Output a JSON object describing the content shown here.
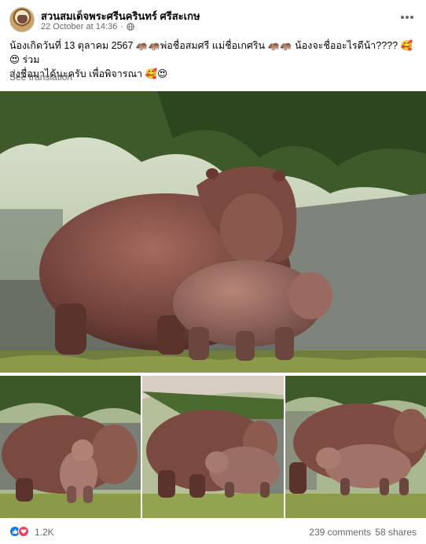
{
  "post": {
    "page_name": "สวนสมเด็จพระศรีนครินทร์ ศรีสะเกษ",
    "timestamp": "22 October at 14:36",
    "privacy_icon": "globe-icon",
    "text_line_1": "น้องเกิดวันที่ 13 ตุลาคม 2567 🦛🦛พ่อชื่อสมศรี แม่ชื่อเกศริน 🦛🦛 น้องจะชื่ออะไรดีน้า???? 🥰😍 ร่วม",
    "text_line_2": "ส่งชื่อมาได้นะครับ เพื่อพิจารณา 🥰😍",
    "see_translation": "See translation"
  },
  "photos": {
    "count": 4,
    "subjects": [
      "adult-hippo-with-calf",
      "adult-hippo-with-calf",
      "adult-hippo-with-calf",
      "adult-hippo-with-calf"
    ]
  },
  "footer": {
    "reactions": [
      "like-icon",
      "love-icon"
    ],
    "reaction_count": "1.2K",
    "comments": "239 comments",
    "shares": "58 shares"
  },
  "colors": {
    "accent_blue": "#1877f2",
    "love_red": "#f33e58",
    "secondary_text": "#65676b"
  }
}
